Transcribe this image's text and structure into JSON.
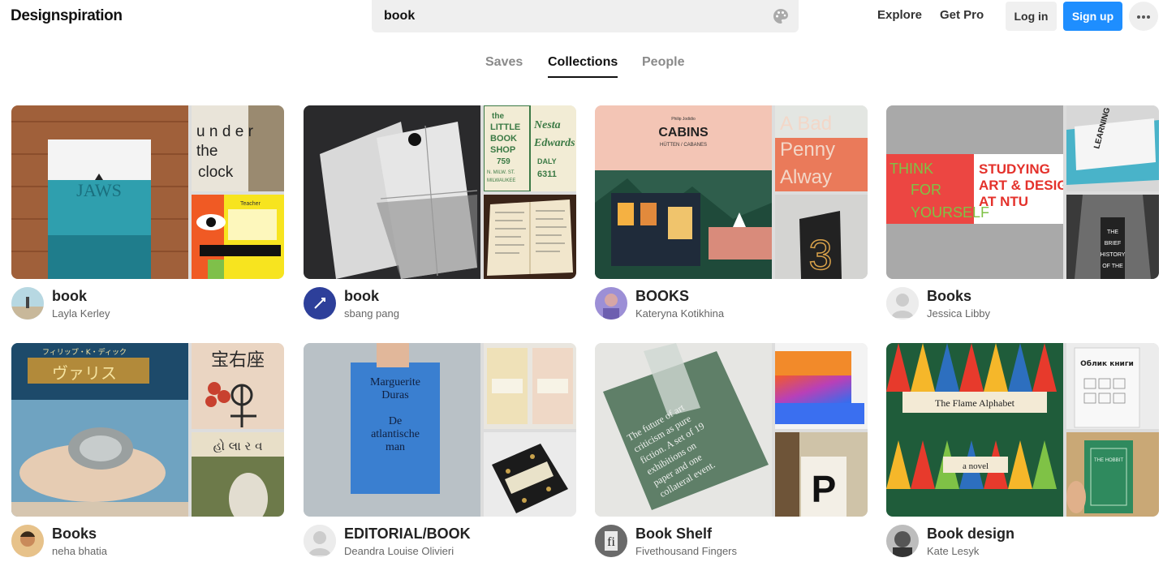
{
  "header": {
    "logo": "Designspiration",
    "search_value": "book",
    "explore_label": "Explore",
    "getpro_label": "Get Pro",
    "login_label": "Log in",
    "signup_label": "Sign up"
  },
  "tabs": [
    {
      "label": "Saves",
      "active": false
    },
    {
      "label": "Collections",
      "active": true
    },
    {
      "label": "People",
      "active": false
    }
  ],
  "collections": [
    {
      "title": "book",
      "owner": "Layla Kerley",
      "main_text": "JAWS",
      "top_text": "under the clock",
      "bot_text": "Teacher"
    },
    {
      "title": "book",
      "owner": "sbang pang",
      "top_text_1": "the LITTLE BOOK SHOP",
      "top_text_2": "759 N. MILW. ST. MILWAUKEE",
      "top_text_3": "Nesta & Edwards",
      "top_text_4": "DALY 6311"
    },
    {
      "title": "BOOKS",
      "owner": "Kateryna Kotikhina",
      "main_text": "CABINS",
      "main_subtext": "HÜTTEN / CABANES",
      "main_author": "Philip Jodidio",
      "top_text": "A Bad Penny Always",
      "bot_text": "3"
    },
    {
      "title": "Books",
      "owner": "Jessica Libby",
      "main_text_1": "THINK FOR YOURSELF",
      "main_text_2": "STUDYING ART & DESIGN AT NTU",
      "top_text": "LEARNING",
      "bot_text": "THE BRIEF HISTORY OF THE"
    },
    {
      "title": "Books",
      "owner": "neha bhatia",
      "main_text": "ヴァリス",
      "main_author": "フィリップ・K・ディック",
      "top_text": "宝右座",
      "bot_text": "હો લા ર વ"
    },
    {
      "title": "EDITORIAL/BOOK",
      "owner": "Deandra Louise Olivieri",
      "main_author": "Marguerite Duras",
      "main_text": "De atlantische man"
    },
    {
      "title": "Book Shelf",
      "owner": "Fivethousand Fingers",
      "main_text": "The future of art criticism as pure fiction. A set of 19 exhibitions on paper and one collateral event.",
      "bot_text": "P"
    },
    {
      "title": "Book design",
      "owner": "Kate Lesyk",
      "main_text": "The Flame Alphabet",
      "main_sub": "a novel",
      "top_text": "Облик книги"
    }
  ],
  "colors": {
    "accent": "#1e8eff",
    "tab_inactive": "#8a8a8a",
    "search_bg": "#efefef"
  }
}
